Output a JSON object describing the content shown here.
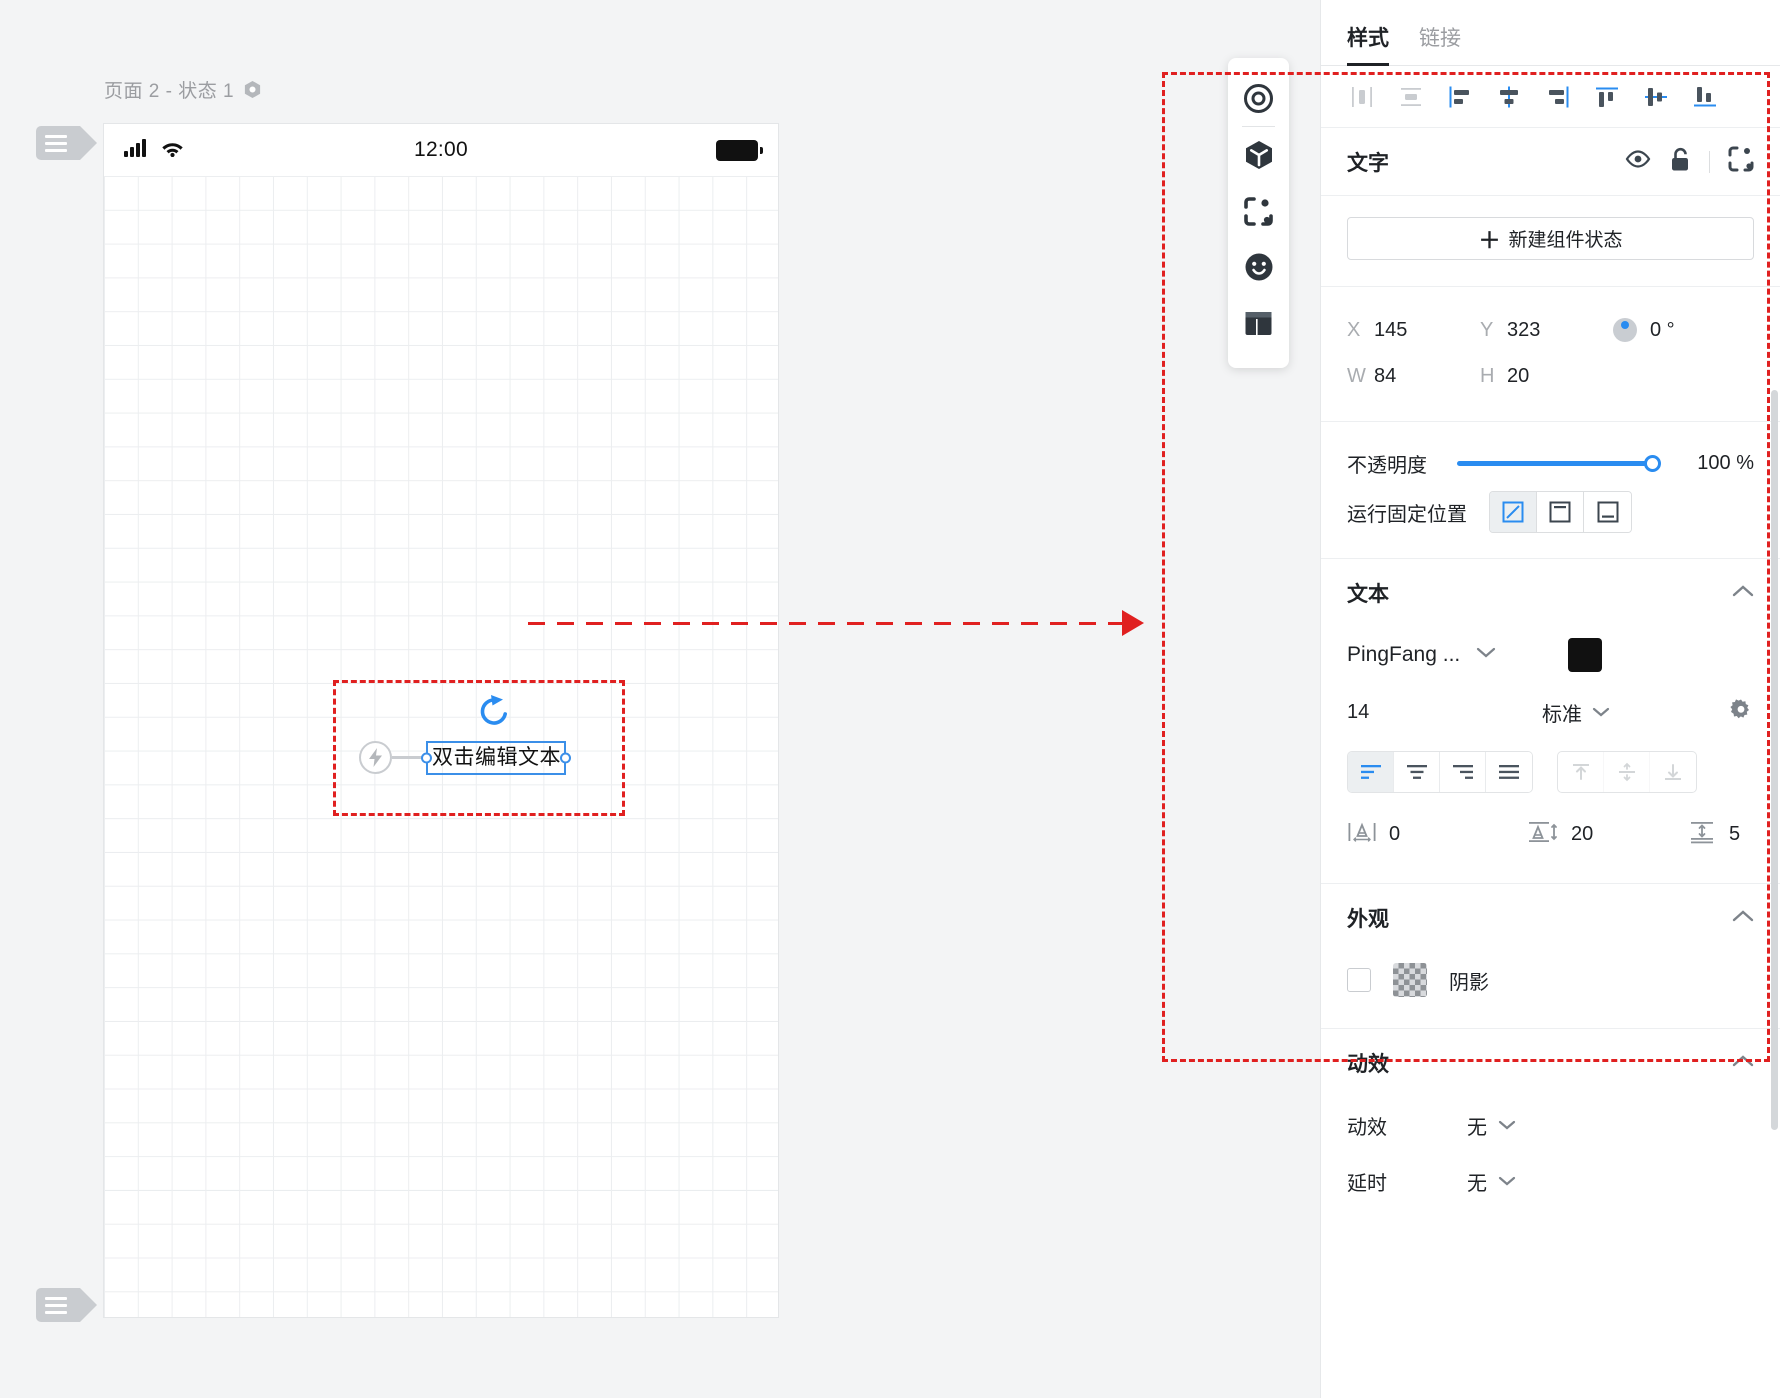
{
  "canvas": {
    "page_title": "页面 2 - 状态 1",
    "page_title_icon": "hexagon-component-icon",
    "statusbar": {
      "signal_icon": "cellular-signal-icon",
      "wifi_icon": "wifi-icon",
      "time": "12:00",
      "battery_icon": "battery-full-icon"
    },
    "selected_element": {
      "text": "双击编辑文本",
      "rotate_icon": "rotate-cw-icon",
      "interaction_icon": "lightning-bolt-icon"
    },
    "pull_tabs": {
      "top_icon": "panel-toggle-icon",
      "bottom_icon": "panel-toggle-icon"
    },
    "vertical_toolbar": [
      {
        "name": "target-icon",
        "label": "目标"
      },
      {
        "name": "cube-icon",
        "label": "组件"
      },
      {
        "name": "scan-icon",
        "label": "扫描"
      },
      {
        "name": "smiley-icon",
        "label": "图标"
      },
      {
        "name": "layout-icon",
        "label": "布局"
      }
    ]
  },
  "panel": {
    "tabs": [
      {
        "label": "样式",
        "active": true
      },
      {
        "label": "链接",
        "active": false
      }
    ],
    "align_buttons": [
      {
        "name": "distribute-horizontal-icon",
        "active": false,
        "enabled": false
      },
      {
        "name": "distribute-vertical-icon",
        "active": false,
        "enabled": false
      },
      {
        "name": "align-left-icon",
        "active": false,
        "enabled": true
      },
      {
        "name": "align-center-horizontal-icon",
        "active": false,
        "enabled": true
      },
      {
        "name": "align-right-icon",
        "active": false,
        "enabled": true
      },
      {
        "name": "align-top-icon",
        "active": false,
        "enabled": true
      },
      {
        "name": "align-middle-vertical-icon",
        "active": false,
        "enabled": true
      },
      {
        "name": "align-bottom-icon",
        "active": false,
        "enabled": true
      }
    ],
    "element_header": {
      "title": "文字",
      "eye_icon": "eye-visible-icon",
      "lock_icon": "unlock-icon",
      "fit_icon": "fit-content-icon"
    },
    "new_state_button": {
      "plus": "＋",
      "label": "新建组件状态"
    },
    "geometry": {
      "x_label": "X",
      "x_value": "145",
      "y_label": "Y",
      "y_value": "323",
      "rotation_value": "0 °",
      "w_label": "W",
      "w_value": "84",
      "h_label": "H",
      "h_value": "20"
    },
    "opacity": {
      "label": "不透明度",
      "value": "100 %",
      "percent": 100,
      "accent": "#2a8cf0"
    },
    "fixed_position": {
      "label": "运行固定位置",
      "options": [
        {
          "name": "fixed-none-icon",
          "active": true
        },
        {
          "name": "fixed-top-icon",
          "active": false
        },
        {
          "name": "fixed-bottom-icon",
          "active": false
        }
      ]
    },
    "text_section": {
      "title": "文本",
      "collapse_icon": "chevron-up-icon",
      "font_family": "PingFang ...",
      "font_dropdown_icon": "chevron-down-icon",
      "color": "#111111",
      "font_size": "14",
      "font_weight": "标准",
      "weight_dropdown_icon": "chevron-down-icon",
      "settings_icon": "gear-icon",
      "horizontal_align": [
        {
          "name": "text-align-left-icon",
          "active": true
        },
        {
          "name": "text-align-center-icon",
          "active": false
        },
        {
          "name": "text-align-right-icon",
          "active": false
        },
        {
          "name": "text-align-justify-icon",
          "active": false
        }
      ],
      "vertical_align": [
        {
          "name": "valign-top-icon",
          "active": false
        },
        {
          "name": "valign-middle-icon",
          "active": false
        },
        {
          "name": "valign-bottom-icon",
          "active": false
        }
      ],
      "letter_spacing_icon": "letter-spacing-icon",
      "letter_spacing": "0",
      "line_height_icon": "line-height-icon",
      "line_height": "20",
      "paragraph_spacing_icon": "paragraph-spacing-icon",
      "paragraph_spacing": "5"
    },
    "appearance_section": {
      "title": "外观",
      "collapse_icon": "chevron-up-icon",
      "shadow_label": "阴影",
      "shadow_checked": false,
      "shadow_swatch": "checkerboard"
    },
    "animation_section": {
      "title": "动效",
      "collapse_icon": "chevron-up-icon",
      "rows": [
        {
          "label": "动效",
          "value": "无",
          "icon": "chevron-down-icon"
        },
        {
          "label": "延时",
          "value": "无",
          "icon": "chevron-down-icon"
        }
      ]
    }
  },
  "annotations": {
    "highlight_color": "#e02020",
    "arrow_icon": "arrow-right-icon"
  }
}
